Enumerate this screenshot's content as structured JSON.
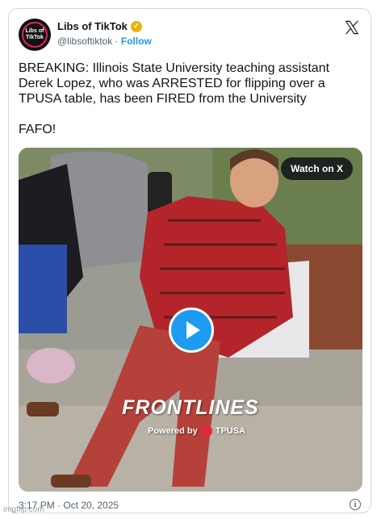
{
  "author": {
    "name": "Libs of TikTok",
    "handle": "@libsoftiktok",
    "separator": "·",
    "follow_label": "Follow",
    "avatar_text": "Libs of TikTok",
    "verified_color": "#e8b40e"
  },
  "tweet": {
    "text": "BREAKING: Illinois State University teaching assistant Derek Lopez, who was ARRESTED for flipping over a TPUSA table, has been FIRED from the University\n\nFAFO!"
  },
  "media": {
    "watch_label": "Watch on X",
    "brand_text": "FRONTLINES",
    "powered_by": "Powered by",
    "powered_brand": "TPUSA",
    "play_icon": "play-icon",
    "accent_color": "#1d9bf0"
  },
  "footer": {
    "timestamp": "3:17 PM · Oct 20, 2025",
    "info_icon": "info-icon"
  },
  "watermark": "imgflip.com"
}
